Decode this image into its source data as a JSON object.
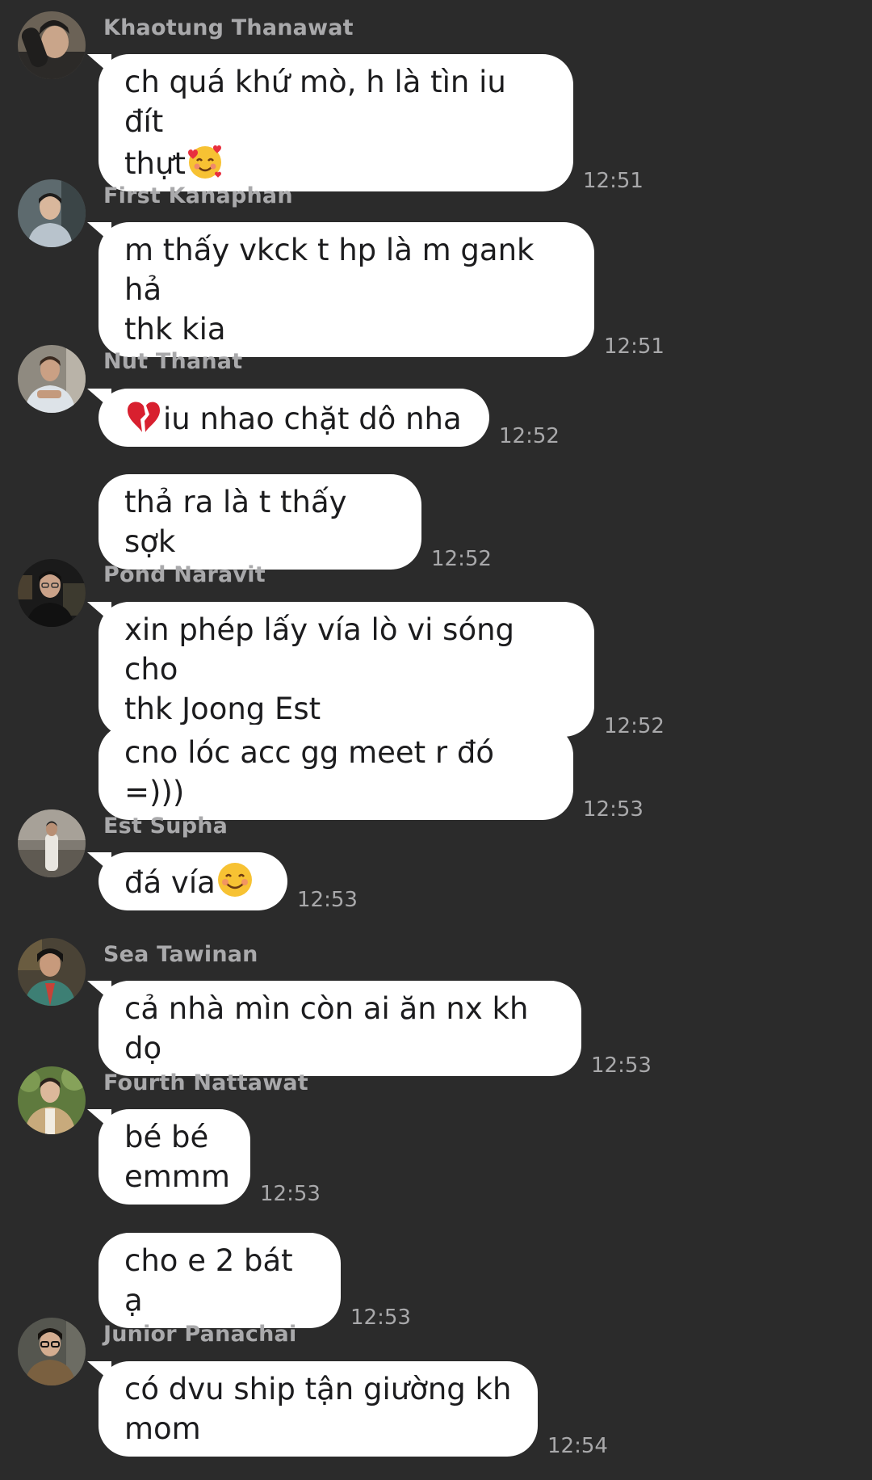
{
  "messages": [
    {
      "sender": "Khaotung Thanawat",
      "avatar_icon": "avatar-khaotung",
      "bubbles": [
        {
          "text": "ch quá khứ mò, h là tìn iu đít\nthựt",
          "emoji_after": "🥰",
          "time": "12:51"
        }
      ]
    },
    {
      "sender": "First Kanaphan",
      "avatar_icon": "avatar-first",
      "bubbles": [
        {
          "text": "m thấy vkck t hp là m gank hả\nthk kia",
          "time": "12:51"
        }
      ]
    },
    {
      "sender": "Nut Thanat",
      "avatar_icon": "avatar-nut",
      "bubbles": [
        {
          "emoji_before": "💔",
          "text": "iu nhao chặt dô nha",
          "time": "12:52"
        },
        {
          "text": "thả ra là t thấy sợk",
          "time": "12:52"
        }
      ]
    },
    {
      "sender": "Pond Naravit",
      "avatar_icon": "avatar-pond",
      "bubbles": [
        {
          "text": "xin phép lấy vía lò vi sóng cho\nthk Joong Est",
          "time": "12:52"
        },
        {
          "text": "cno lóc acc gg meet r đó =)))",
          "time": "12:53"
        }
      ]
    },
    {
      "sender": "Est Supha",
      "avatar_icon": "avatar-est",
      "bubbles": [
        {
          "text": "đá vía",
          "emoji_after": "😊",
          "time": "12:53"
        }
      ]
    },
    {
      "sender": "Sea Tawinan",
      "avatar_icon": "avatar-sea",
      "bubbles": [
        {
          "text": "cả nhà mìn còn ai ăn nx kh dọ",
          "time": "12:53"
        }
      ]
    },
    {
      "sender": "Fourth Nattawat",
      "avatar_icon": "avatar-fourth",
      "bubbles": [
        {
          "text": "bé bé\nemmm",
          "time": "12:53"
        },
        {
          "text": "cho e 2 bát ạ",
          "time": "12:53"
        }
      ]
    },
    {
      "sender": "Junior Panachai",
      "avatar_icon": "avatar-junior",
      "bubbles": [
        {
          "text": "có dvu ship tận giường kh\nmom",
          "time": "12:54"
        }
      ]
    }
  ],
  "colors": {
    "background": "#2b2b2b",
    "bubble": "#ffffff",
    "bubble_text": "#1c1c1e",
    "meta_text": "#a9a9ab"
  }
}
